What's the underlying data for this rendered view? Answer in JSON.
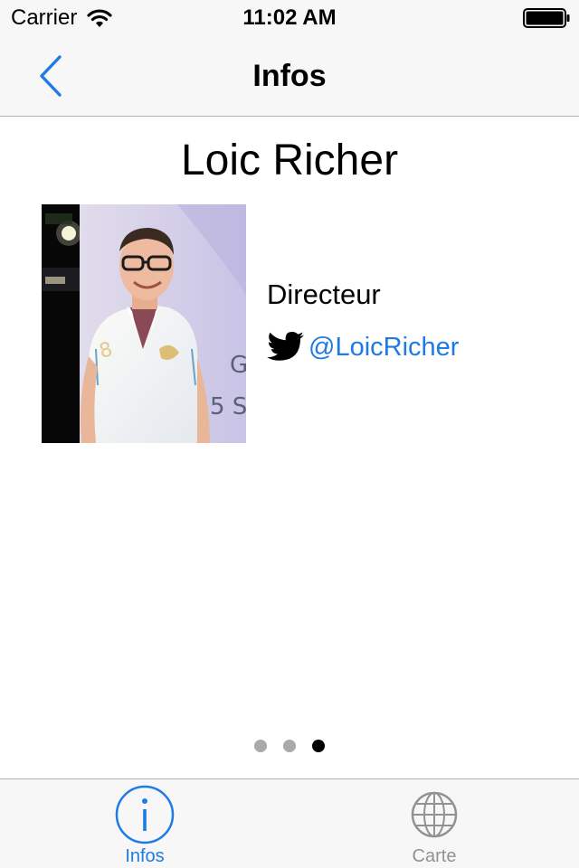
{
  "status_bar": {
    "carrier": "Carrier",
    "time": "11:02 AM",
    "wifi_icon": "wifi-icon",
    "battery_icon": "battery-icon"
  },
  "nav_bar": {
    "title": "Infos",
    "back_icon": "chevron-left-icon"
  },
  "profile": {
    "name": "Loic Richer",
    "role": "Directeur",
    "twitter_icon": "twitter-bird-icon",
    "twitter_handle": "@LoicRicher",
    "photo_overlay_text": [
      "G",
      "5 S"
    ]
  },
  "page_control": {
    "page_count": 3,
    "current_page": 3
  },
  "tab_bar": {
    "items": [
      {
        "label": "Infos",
        "icon": "info-icon",
        "selected": true
      },
      {
        "label": "Carte",
        "icon": "globe-icon",
        "selected": false
      }
    ]
  },
  "colors": {
    "accent": "#1f7ae6",
    "bar_background": "#f7f7f7",
    "inactive_tab": "#929292",
    "page_dot_inactive": "#aaaaaa",
    "page_dot_active": "#000000"
  }
}
